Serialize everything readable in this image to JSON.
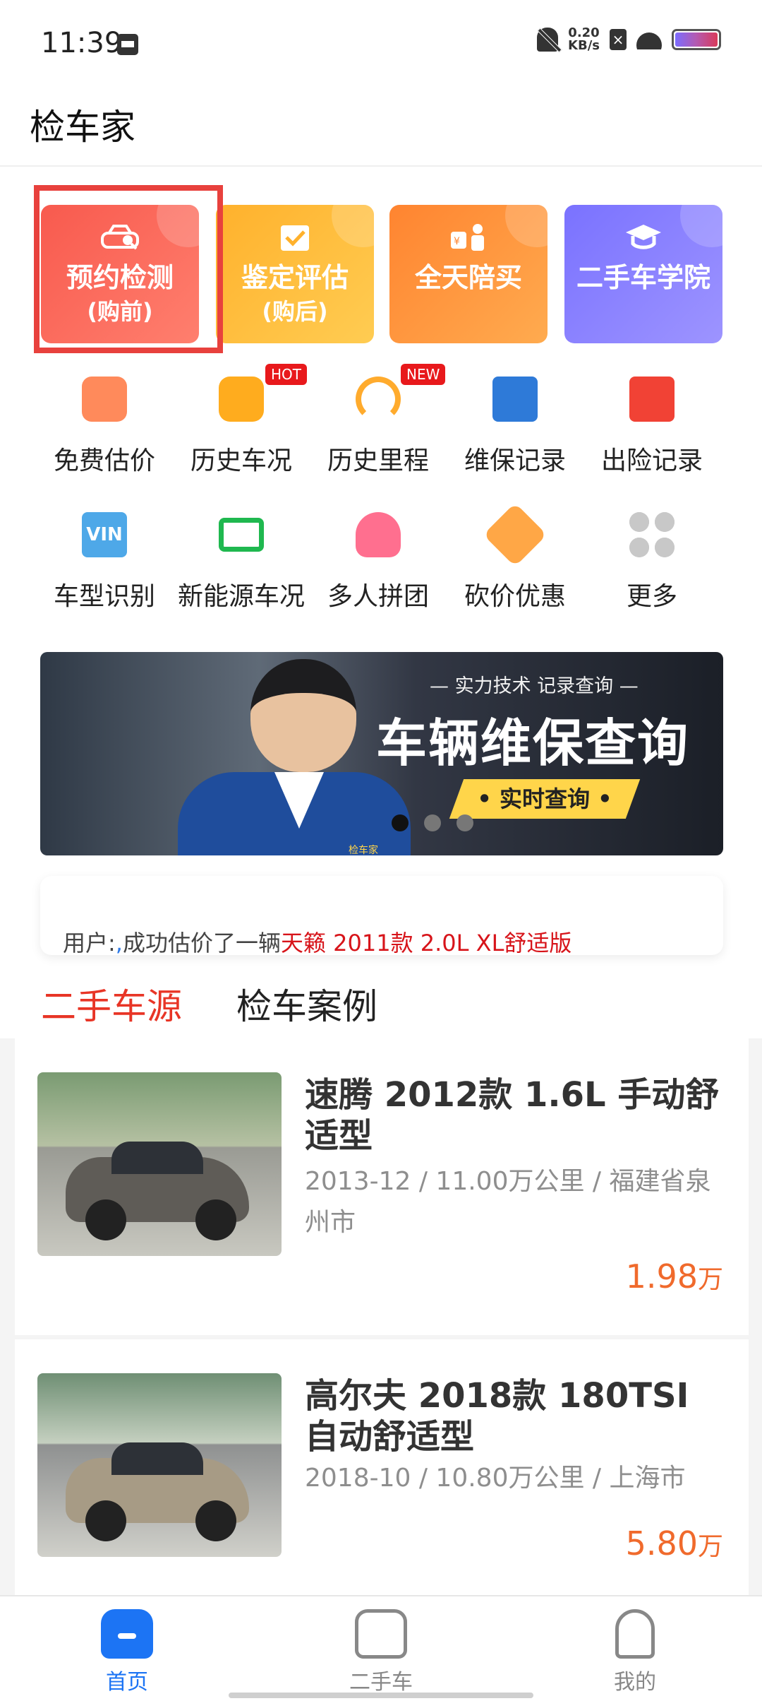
{
  "status_bar": {
    "time": "11:39",
    "network_speed_value": "0.20",
    "network_speed_unit": "KB/s",
    "icons": [
      "calendar-icon",
      "bell-off-icon",
      "sim-x-icon",
      "wifi-icon",
      "battery-icon"
    ]
  },
  "app": {
    "title": "检车家"
  },
  "quick_cards": [
    {
      "title": "预约检测",
      "subtitle": "(购前)",
      "icon": "car-search-icon",
      "color": "#f85a4e"
    },
    {
      "title": "鉴定评估",
      "subtitle": "(购后)",
      "icon": "clipboard-check-icon",
      "color": "#ffb12c"
    },
    {
      "title": "全天陪买",
      "icon": "shopping-person-icon",
      "color": "#ff8430"
    },
    {
      "title": "二手车学院",
      "icon": "graduation-cap-icon",
      "color": "#7a72ff"
    }
  ],
  "service_icons": [
    {
      "label": "免费估价",
      "icon": "calculator-icon"
    },
    {
      "label": "历史车况",
      "icon": "car-history-icon",
      "tag": "HOT"
    },
    {
      "label": "历史里程",
      "icon": "odometer-icon",
      "tag": "NEW"
    },
    {
      "label": "维保记录",
      "icon": "maintenance-record-icon"
    },
    {
      "label": "出险记录",
      "icon": "accident-record-icon"
    },
    {
      "label": "车型识别",
      "icon": "vin-icon",
      "icon_text": "VIN"
    },
    {
      "label": "新能源车况",
      "icon": "battery-icon"
    },
    {
      "label": "多人拼团",
      "icon": "group-icon"
    },
    {
      "label": "砍价优惠",
      "icon": "price-tag-icon"
    },
    {
      "label": "更多",
      "icon": "more-grid-icon"
    }
  ],
  "banner": {
    "subtitle": "— 实力技术 记录查询 —",
    "title": "车辆维保查询",
    "button": "• 实时查询 •",
    "person_badge": "检车家",
    "dots": 3,
    "active_dot": 0
  },
  "notice": {
    "prefix": "用户:",
    "separator": ",",
    "text": "成功估价了一辆",
    "highlight": "天籁 2011款 2.0L XL舒适版"
  },
  "tabs": {
    "active": "二手车源",
    "inactive": "检车案例"
  },
  "listings": [
    {
      "title": "速腾 2012款 1.6L 手动舒适型",
      "meta": "2013-12 / 11.00万公里 / 福建省泉州市",
      "price": "1.98",
      "unit": "万",
      "car_color": "dark grey"
    },
    {
      "title": "高尔夫 2018款 180TSI 自动舒适型",
      "meta": "2018-10 / 10.80万公里 / 上海市",
      "price": "5.80",
      "unit": "万",
      "car_color": "champagne"
    }
  ],
  "bottom_nav": {
    "home": "首页",
    "cars": "二手车",
    "me": "我的"
  },
  "colors": {
    "accent_red": "#e83526",
    "price_orange": "#f06a2c",
    "blue": "#1c74f4"
  }
}
